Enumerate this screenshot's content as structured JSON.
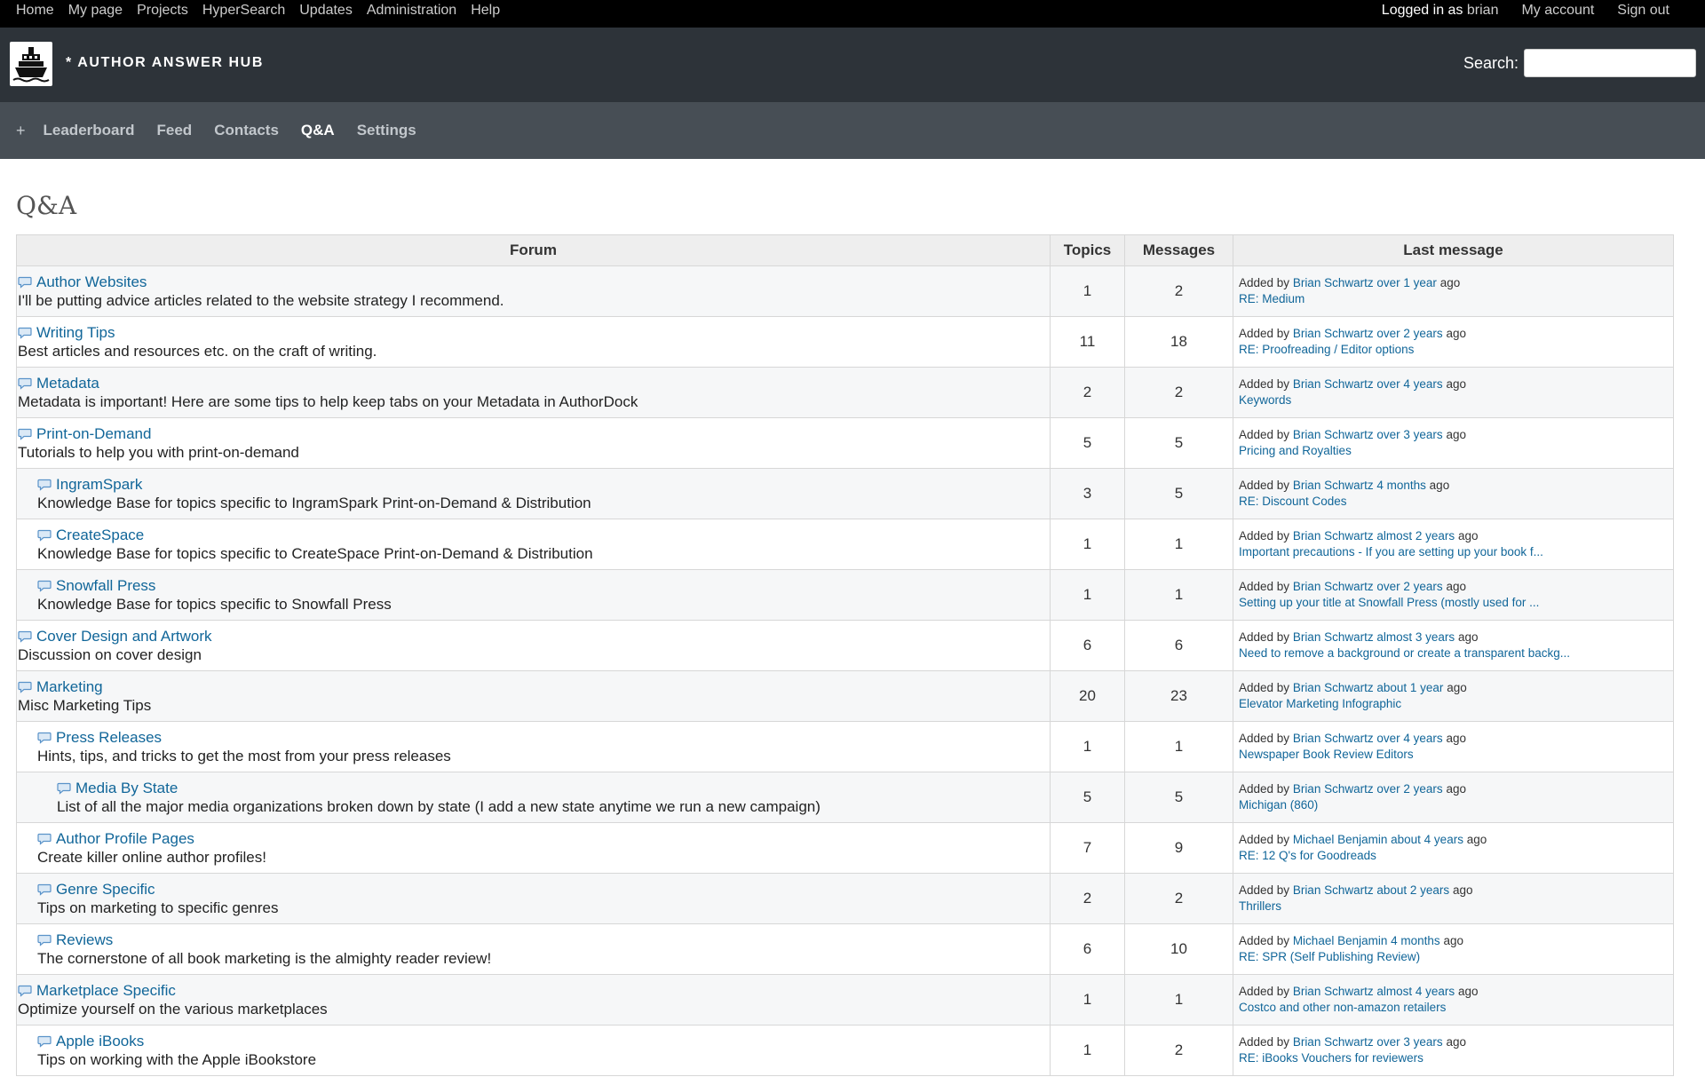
{
  "top_menu": {
    "left": [
      "Home",
      "My page",
      "Projects",
      "HyperSearch",
      "Updates",
      "Administration",
      "Help"
    ],
    "logged_in_prefix": "Logged in as",
    "user": "brian",
    "my_account": "My account",
    "sign_out": "Sign out"
  },
  "header": {
    "logo_icon": "ship-icon",
    "title": "* AUTHOR ANSWER HUB",
    "search_label": "Search:",
    "search_value": ""
  },
  "main_menu": {
    "plus": "+",
    "items": [
      "Leaderboard",
      "Feed",
      "Contacts",
      "Q&A",
      "Settings"
    ],
    "selected": "Q&A"
  },
  "page": {
    "title": "Q&A"
  },
  "forums_table": {
    "headers": {
      "forum": "Forum",
      "topics": "Topics",
      "messages": "Messages",
      "last": "Last message"
    },
    "added_by": "Added by",
    "ago": "ago",
    "rows": [
      {
        "level": 0,
        "name": "Author Websites",
        "desc": "I'll be putting advice articles related to the website strategy I recommend.",
        "topics": "1",
        "messages": "2",
        "author": "Brian Schwartz",
        "when": "over 1 year",
        "last": "RE: Medium"
      },
      {
        "level": 0,
        "name": "Writing Tips",
        "desc": "Best articles and resources etc. on the craft of writing.",
        "topics": "11",
        "messages": "18",
        "author": "Brian Schwartz",
        "when": "over 2 years",
        "last": "RE: Proofreading / Editor options"
      },
      {
        "level": 0,
        "name": "Metadata",
        "desc": "Metadata is important! Here are some tips to help keep tabs on your Metadata in AuthorDock",
        "topics": "2",
        "messages": "2",
        "author": "Brian Schwartz",
        "when": "over 4 years",
        "last": "Keywords"
      },
      {
        "level": 0,
        "name": "Print-on-Demand",
        "desc": "Tutorials to help you with print-on-demand",
        "topics": "5",
        "messages": "5",
        "author": "Brian Schwartz",
        "when": "over 3 years",
        "last": "Pricing and Royalties"
      },
      {
        "level": 1,
        "name": "IngramSpark",
        "desc": "Knowledge Base for topics specific to IngramSpark Print-on-Demand & Distribution",
        "topics": "3",
        "messages": "5",
        "author": "Brian Schwartz",
        "when": "4 months",
        "last": "RE: Discount Codes"
      },
      {
        "level": 1,
        "name": "CreateSpace",
        "desc": "Knowledge Base for topics specific to CreateSpace Print-on-Demand & Distribution",
        "topics": "1",
        "messages": "1",
        "author": "Brian Schwartz",
        "when": "almost 2 years",
        "last": "Important precautions - If you are setting up your book f..."
      },
      {
        "level": 1,
        "name": "Snowfall Press",
        "desc": "Knowledge Base for topics specific to Snowfall Press",
        "topics": "1",
        "messages": "1",
        "author": "Brian Schwartz",
        "when": "over 2 years",
        "last": "Setting up your title at Snowfall Press (mostly used for ..."
      },
      {
        "level": 0,
        "name": "Cover Design and Artwork",
        "desc": "Discussion on cover design",
        "topics": "6",
        "messages": "6",
        "author": "Brian Schwartz",
        "when": "almost 3 years",
        "last": "Need to remove a background or create a transparent backg..."
      },
      {
        "level": 0,
        "name": "Marketing",
        "desc": "Misc Marketing Tips",
        "topics": "20",
        "messages": "23",
        "author": "Brian Schwartz",
        "when": "about 1 year",
        "last": "Elevator Marketing Infographic"
      },
      {
        "level": 1,
        "name": "Press Releases",
        "desc": "Hints, tips, and tricks to get the most from your press releases",
        "topics": "1",
        "messages": "1",
        "author": "Brian Schwartz",
        "when": "over 4 years",
        "last": "Newspaper Book Review Editors"
      },
      {
        "level": 2,
        "name": "Media By State",
        "desc": "List of all the major media organizations broken down by state (I add a new state anytime we run a new campaign)",
        "topics": "5",
        "messages": "5",
        "author": "Brian Schwartz",
        "when": "over 2 years",
        "last": "Michigan (860)"
      },
      {
        "level": 1,
        "name": "Author Profile Pages",
        "desc": "Create killer online author profiles!",
        "topics": "7",
        "messages": "9",
        "author": "Michael Benjamin",
        "when": "about 4 years",
        "last": "RE: 12 Q's for Goodreads"
      },
      {
        "level": 1,
        "name": "Genre Specific",
        "desc": "Tips on marketing to specific genres",
        "topics": "2",
        "messages": "2",
        "author": "Brian Schwartz",
        "when": "about 2 years",
        "last": "Thrillers"
      },
      {
        "level": 1,
        "name": "Reviews",
        "desc": "The cornerstone of all book marketing is the almighty reader review!",
        "topics": "6",
        "messages": "10",
        "author": "Michael Benjamin",
        "when": "4 months",
        "last": "RE: SPR (Self Publishing Review)"
      },
      {
        "level": 0,
        "name": "Marketplace Specific",
        "desc": "Optimize yourself on the various marketplaces",
        "topics": "1",
        "messages": "1",
        "author": "Brian Schwartz",
        "when": "almost 4 years",
        "last": "Costco and other non-amazon retailers"
      },
      {
        "level": 1,
        "name": "Apple iBooks",
        "desc": "Tips on working with the Apple iBookstore",
        "topics": "1",
        "messages": "2",
        "author": "Brian Schwartz",
        "when": "over 3 years",
        "last": "RE: iBooks Vouchers for reviewers"
      }
    ]
  },
  "colors": {
    "top_bar": "#000000",
    "header": "#2d3339",
    "nav": "#474e55",
    "link": "#116699"
  }
}
